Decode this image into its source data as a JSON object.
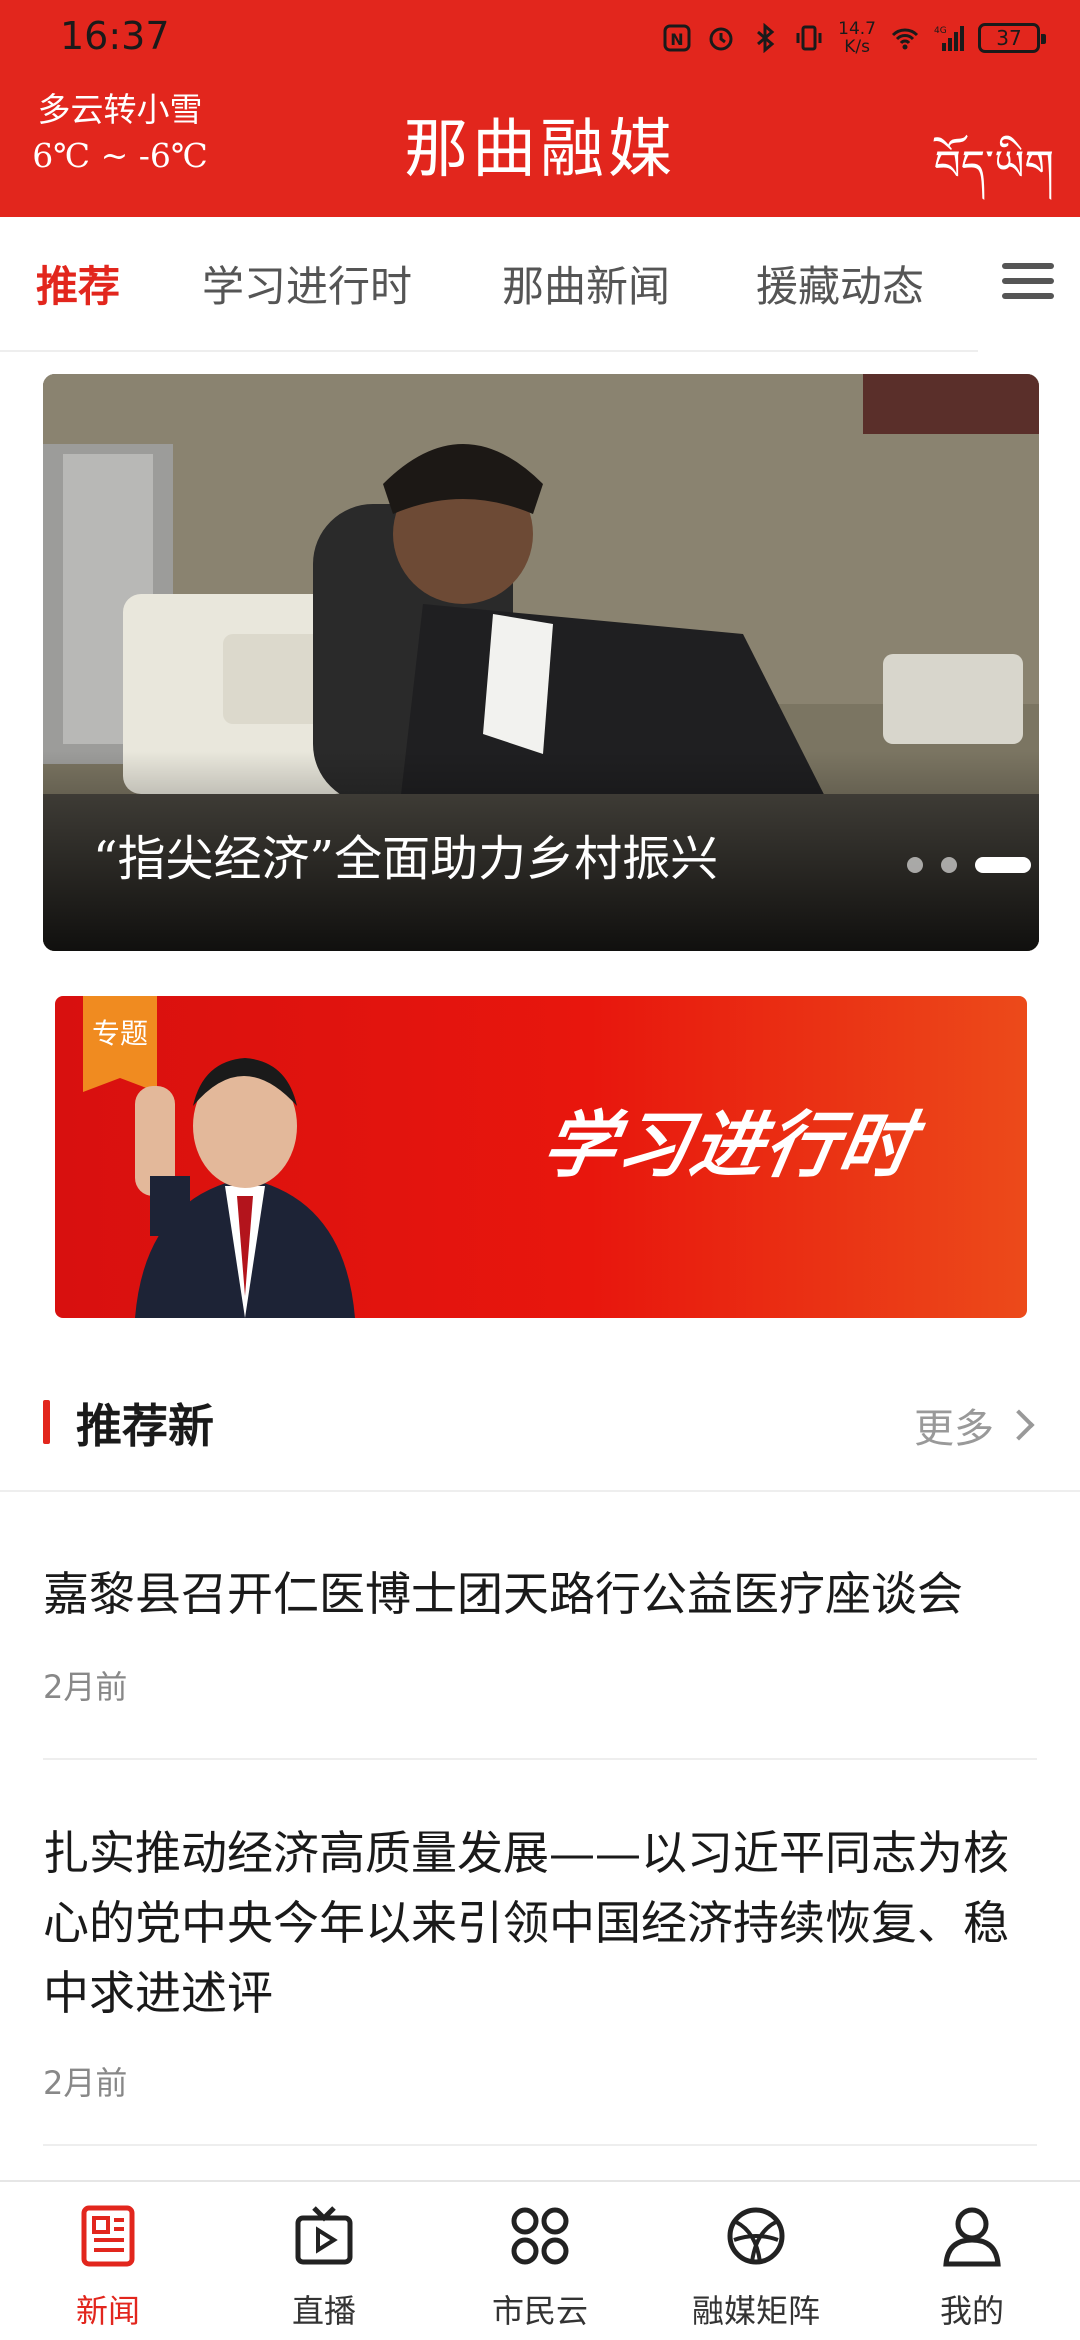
{
  "status_bar": {
    "time": "16:37",
    "net_speed_value": "14.7",
    "net_speed_unit": "K/s",
    "battery": "37",
    "icons": [
      "nfc-icon",
      "alarm-icon",
      "bluetooth-icon",
      "vibrate-icon",
      "wifi-icon",
      "signal-4g-icon",
      "battery-icon"
    ]
  },
  "header": {
    "weather_desc": "多云转小雪",
    "weather_temp": "6℃ ~ -6℃",
    "title": "那曲融媒",
    "tibetan_name": "བོད་ཡིག",
    "accent_color": "#e2261d"
  },
  "tabs": {
    "items": [
      {
        "label": "推荐",
        "active": true
      },
      {
        "label": "学习进行时",
        "active": false
      },
      {
        "label": "那曲新闻",
        "active": false
      },
      {
        "label": "援藏动态",
        "active": false
      }
    ],
    "menu_icon": "menu-icon"
  },
  "carousel": {
    "caption": "“指尖经济”全面助力乡村振兴",
    "slide_count": 3,
    "active_index": 3
  },
  "banner": {
    "tag": "专题",
    "slogan": "学习进行时"
  },
  "section": {
    "title": "推荐新",
    "more_label": "更多"
  },
  "news": [
    {
      "title": "嘉黎县召开仁医博士团天路行公益医疗座谈会",
      "time": "2月前"
    },
    {
      "title": "扎实推动经济高质量发展——以习近平同志为核心的党中央今年以来引领中国经济持续恢复、稳中求进述评",
      "time": "2月前"
    }
  ],
  "bottom_nav": [
    {
      "label": "新闻",
      "icon": "news-icon",
      "active": true
    },
    {
      "label": "直播",
      "icon": "live-tv-icon",
      "active": false
    },
    {
      "label": "市民云",
      "icon": "apps-grid-icon",
      "active": false
    },
    {
      "label": "融媒矩阵",
      "icon": "media-matrix-icon",
      "active": false
    },
    {
      "label": "我的",
      "icon": "profile-icon",
      "active": false
    }
  ]
}
